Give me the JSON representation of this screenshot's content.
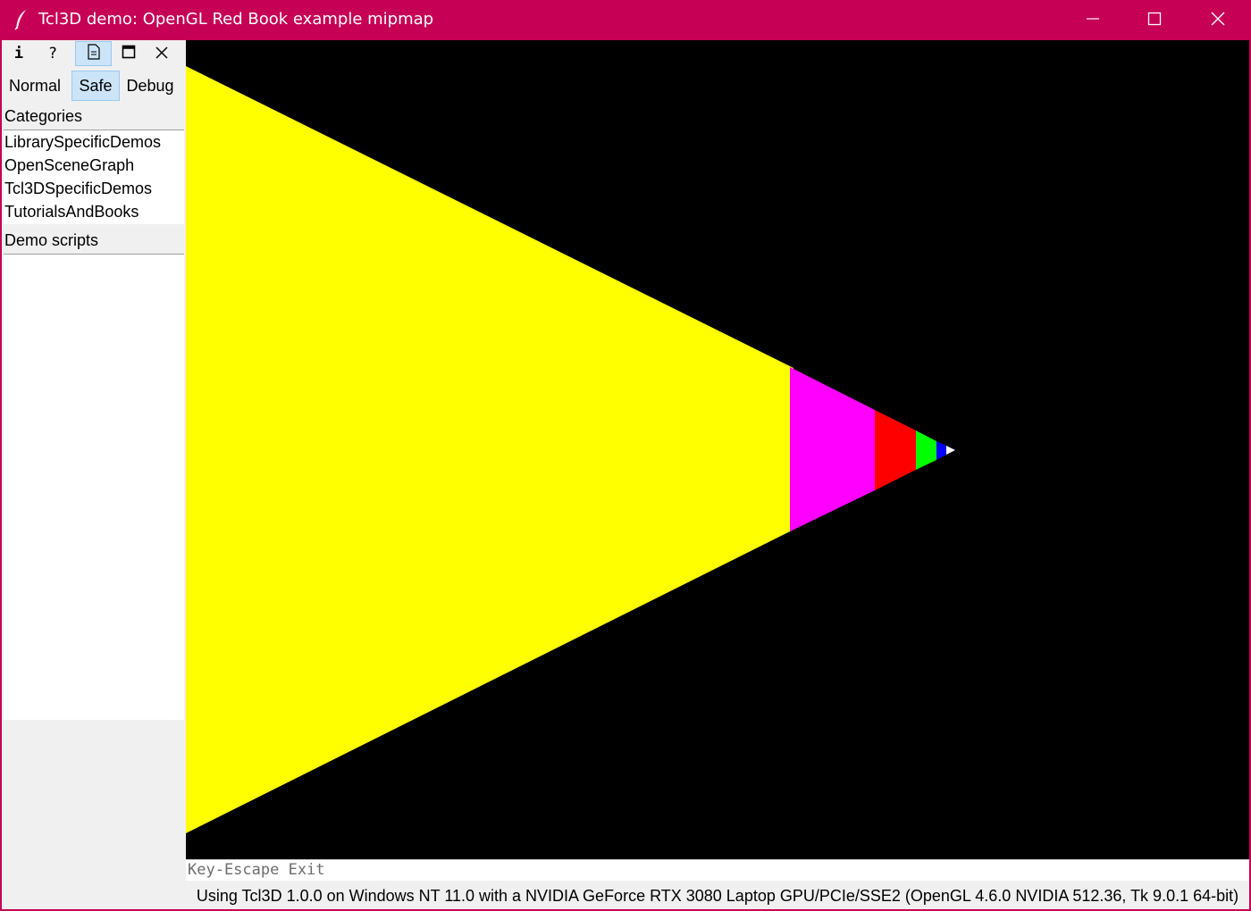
{
  "window": {
    "title": "Tcl3D demo: OpenGL Red Book example mipmap",
    "accent_color": "#c60055"
  },
  "toolbar": {
    "info_label": "i",
    "help_label": "?",
    "icons": [
      "info-icon",
      "help-icon",
      "document-icon",
      "maximize-icon",
      "close-icon"
    ]
  },
  "modes": {
    "normal": "Normal",
    "safe": "Safe",
    "debug": "Debug",
    "selected": "Safe"
  },
  "categories": {
    "label": "Categories",
    "items": [
      "LibrarySpecificDemos",
      "OpenSceneGraph",
      "Tcl3DSpecificDemos",
      "TutorialsAndBooks"
    ]
  },
  "demo_scripts": {
    "label": "Demo scripts",
    "items": []
  },
  "canvas": {
    "background": "#000000",
    "mipmap_colors": [
      "#ffff00",
      "#ff00ff",
      "#ff0000",
      "#00ff00",
      "#0000ff",
      "#ffffff"
    ]
  },
  "console": {
    "text": "Key-Escape Exit"
  },
  "status": {
    "text": "Using Tcl3D 1.0.0 on Windows NT 11.0 with a NVIDIA GeForce RTX 3080 Laptop GPU/PCIe/SSE2 (OpenGL 4.6.0 NVIDIA 512.36, Tk 9.0.1 64-bit)"
  }
}
